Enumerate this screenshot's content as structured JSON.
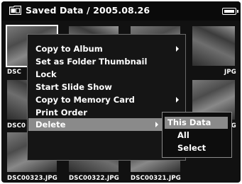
{
  "header": {
    "title": "Saved Data / 2005.08.26",
    "folder_icon": "folder-icon",
    "battery_icon": "battery-full-icon"
  },
  "thumbnails": {
    "names": [
      "DSC",
      "JPG",
      "DSC0",
      "JPG",
      "DSC00323.JPG",
      "DSC00322.JPG",
      "DSC00321.JPG"
    ]
  },
  "menu": {
    "items": [
      {
        "label": "Copy to Album",
        "submenu": true
      },
      {
        "label": "Set as Folder Thumbnail",
        "submenu": false
      },
      {
        "label": "Lock",
        "submenu": false
      },
      {
        "label": "Start Slide Show",
        "submenu": false
      },
      {
        "label": "Copy to Memory Card",
        "submenu": true
      },
      {
        "label": "Print Order",
        "submenu": false
      },
      {
        "label": "Delete",
        "submenu": true
      }
    ],
    "selected": "Delete"
  },
  "submenu": {
    "items": [
      "This Data",
      "All",
      "Select"
    ],
    "selected": "This Data"
  },
  "colors": {
    "background": "#111111",
    "highlight": "#8a8a8a",
    "text": "#ffffff"
  }
}
